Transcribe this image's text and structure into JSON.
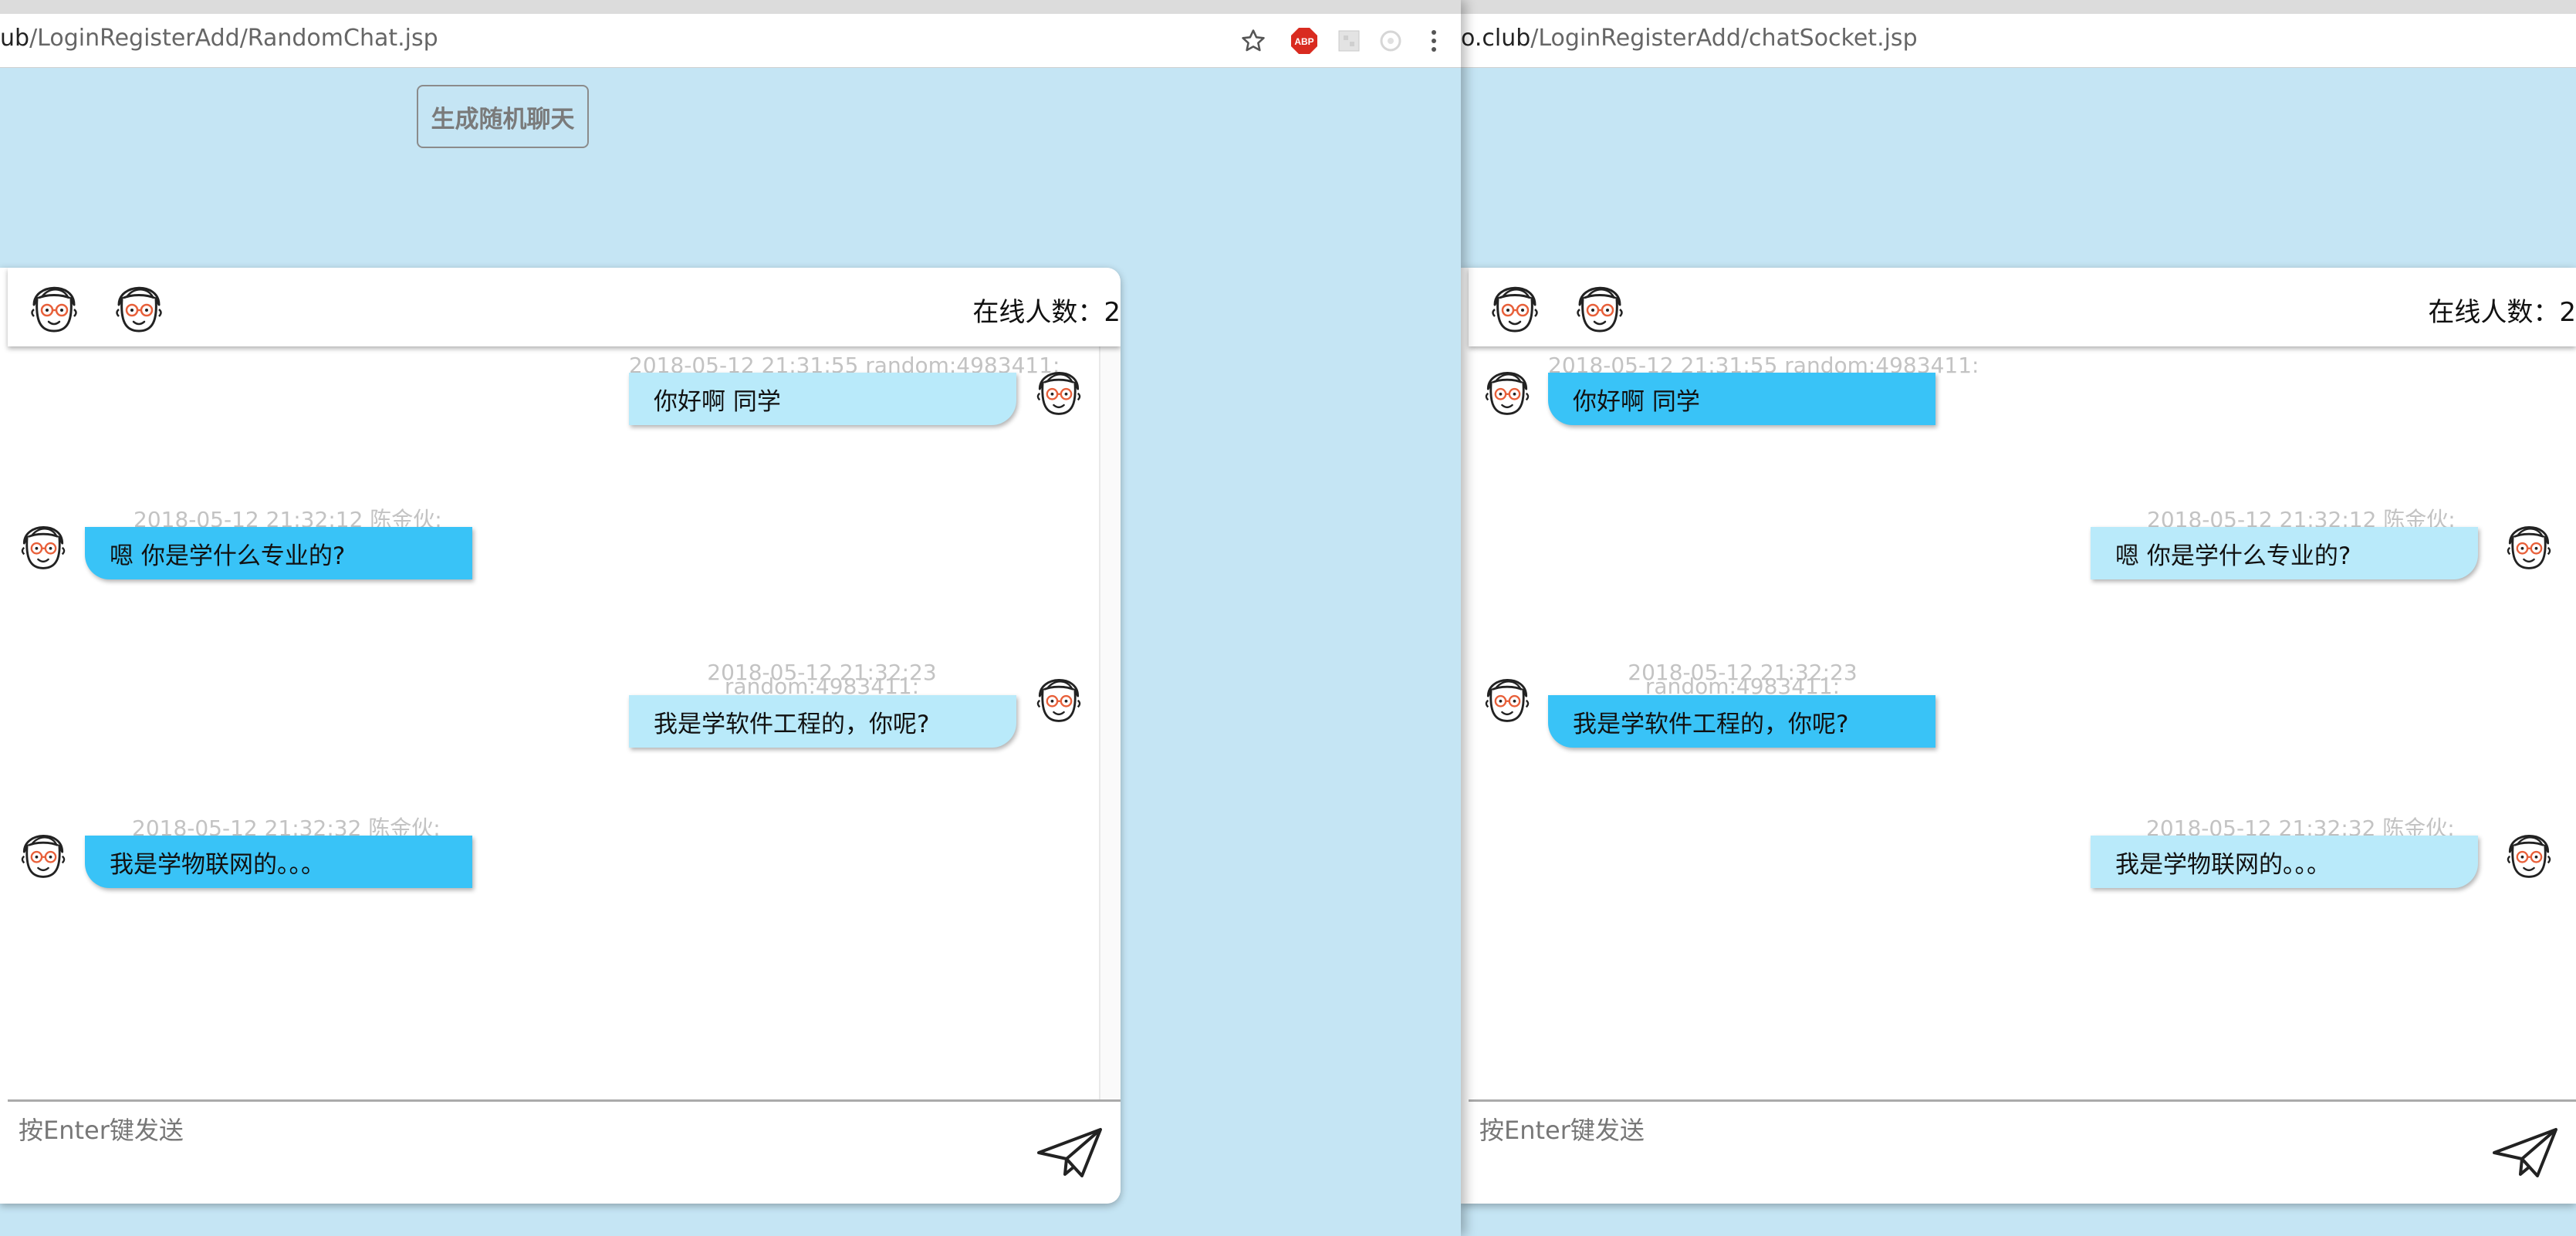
{
  "left_window": {
    "url_host": "ub",
    "url_path": "/LoginRegisterAdd/RandomChat.jsp",
    "random_chat_button": "生成随机聊天",
    "online_label": "在线人数：",
    "online_count": "2",
    "messages": [
      {
        "meta": "2018-05-12 21:31:55 random:4983411:",
        "text": "你好啊 同学"
      },
      {
        "meta": "2018-05-12 21:32:12 陈金伙:",
        "text": "嗯 你是学什么专业的?"
      },
      {
        "meta_line1": "2018-05-12 21:32:23",
        "meta_line2": "random:4983411:",
        "text": "我是学软件工程的，你呢?"
      },
      {
        "meta": "2018-05-12 21:32:32 陈金伙:",
        "text": "我是学物联网的。。。"
      }
    ],
    "input_placeholder": "按Enter键发送"
  },
  "right_window": {
    "url_host": "o.club",
    "url_path": "/LoginRegisterAdd/chatSocket.jsp",
    "online_label": "在线人数：",
    "online_count": "2",
    "messages": [
      {
        "meta": "2018-05-12 21:31:55 random:4983411:",
        "text": "你好啊 同学"
      },
      {
        "meta": "2018-05-12 21:32:12 陈金伙:",
        "text": "嗯 你是学什么专业的?"
      },
      {
        "meta_line1": "2018-05-12 21:32:23",
        "meta_line2": "random:4983411:",
        "text": "我是学软件工程的，你呢?"
      },
      {
        "meta": "2018-05-12 21:32:32 陈金伙:",
        "text": "我是学物联网的。。。"
      }
    ],
    "input_placeholder": "按Enter键发送"
  },
  "toolbar": {
    "adblock_badge": "ABP"
  },
  "icons": [
    "star-icon",
    "adblock-icon",
    "extension-icon",
    "extension-icon-2",
    "menu-kebab-icon",
    "avatar-face-icon",
    "send-plane-icon"
  ],
  "colors": {
    "page_bg": "#c5e5f4",
    "bubble_light": "#b9eafa",
    "bubble_dark": "#39c3f7",
    "adblock": "#d92b20"
  }
}
